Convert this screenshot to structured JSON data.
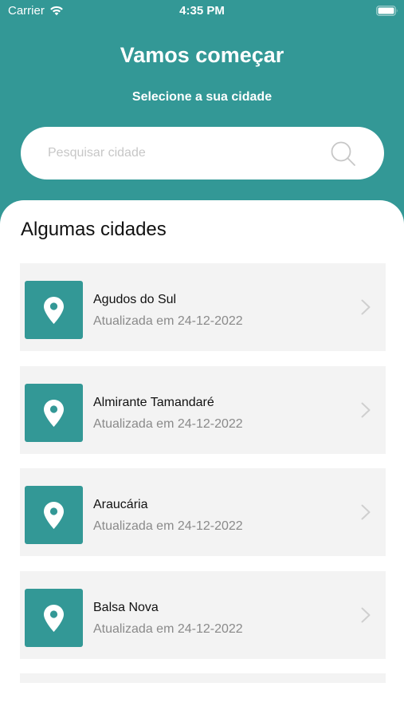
{
  "status_bar": {
    "carrier": "Carrier",
    "time": "4:35 PM",
    "wifi_icon": "wifi-icon",
    "battery_icon": "battery-icon"
  },
  "header": {
    "title": "Vamos começar",
    "subtitle": "Selecione a sua cidade"
  },
  "search": {
    "placeholder": "Pesquisar cidade",
    "value": "",
    "icon": "search-icon"
  },
  "section": {
    "title": "Algumas cidades"
  },
  "cities": [
    {
      "name": "Agudos do Sul",
      "updated": "Atualizada em 24-12-2022"
    },
    {
      "name": "Almirante Tamandaré",
      "updated": "Atualizada em 24-12-2022"
    },
    {
      "name": "Araucária",
      "updated": "Atualizada em 24-12-2022"
    },
    {
      "name": "Balsa Nova",
      "updated": "Atualizada em 24-12-2022"
    }
  ],
  "colors": {
    "brand": "#339896",
    "card_bg": "#f3f3f3",
    "secondary_text": "#8a8a8a"
  },
  "icons": {
    "city_pin": "map-pin-icon",
    "row_chevron": "chevron-right-icon"
  }
}
